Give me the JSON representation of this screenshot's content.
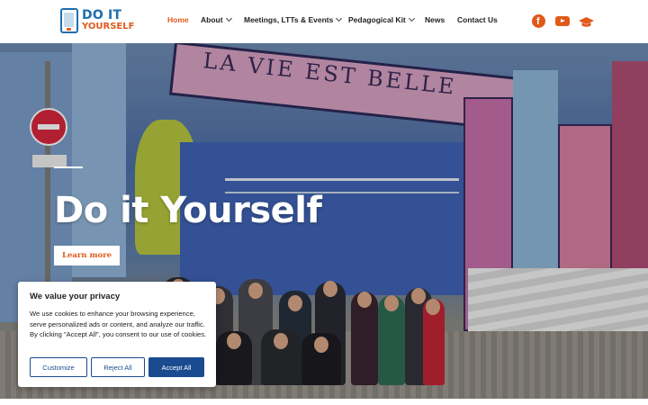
{
  "header": {
    "logo": {
      "line1": "DO IT",
      "line2": "YOURSELF"
    },
    "nav": [
      {
        "label": "Home",
        "active": true,
        "has_dropdown": false
      },
      {
        "label": "About",
        "active": false,
        "has_dropdown": true
      },
      {
        "label": "Meetings, LTTs & Events",
        "active": false,
        "has_dropdown": true
      },
      {
        "label": "Pedagogical Kit",
        "active": false,
        "has_dropdown": true
      },
      {
        "label": "News",
        "active": false,
        "has_dropdown": false
      },
      {
        "label": "Contact Us",
        "active": false,
        "has_dropdown": false
      }
    ],
    "social": [
      {
        "icon": "facebook-icon"
      },
      {
        "icon": "youtube-icon"
      },
      {
        "icon": "graduation-cap-icon"
      }
    ],
    "accent_color": "#e05a1a",
    "logo_color": "#1e6fb0"
  },
  "hero": {
    "mural_text": "LA VIE EST BELLE",
    "title": "Do it Yourself",
    "button_label": "Learn more"
  },
  "cookie": {
    "title": "We value your privacy",
    "body": "We use cookies to enhance your browsing experience, serve personalized ads or content, and analyze our traffic. By clicking \"Accept All\", you consent to our use of cookies.",
    "customize_label": "Customize",
    "reject_label": "Reject All",
    "accept_label": "Accept All",
    "button_color": "#1a4b8f"
  }
}
